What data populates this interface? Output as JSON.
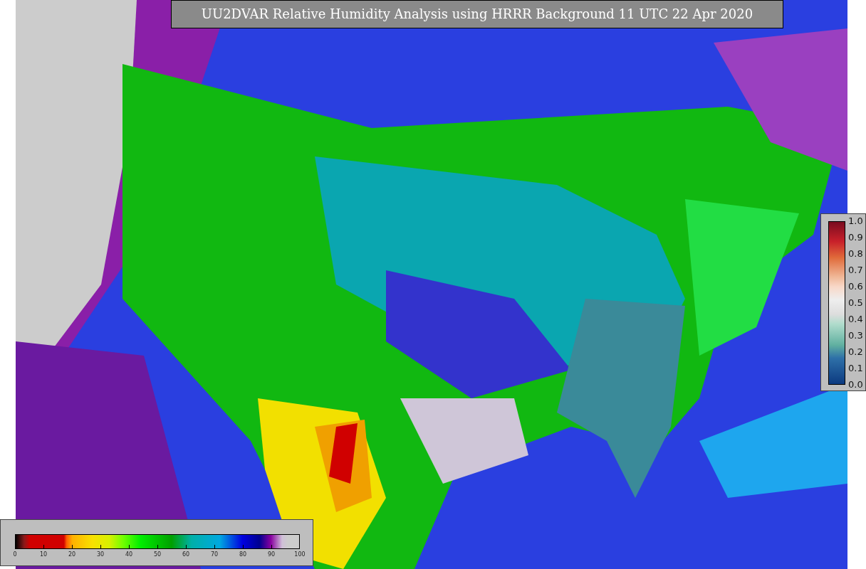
{
  "title": "UU2DVAR Relative Humidity Analysis using HRRR Background 11 UTC 22 Apr 2020",
  "humidity_scale": {
    "ticks": [
      "0",
      "10",
      "20",
      "30",
      "40",
      "50",
      "60",
      "70",
      "80",
      "90",
      "100"
    ]
  },
  "observation_scale": {
    "ticks": [
      "1.0",
      "0.9",
      "0.8",
      "0.7",
      "0.6",
      "0.5",
      "0.4",
      "0.3",
      "0.2",
      "0.1",
      "0.0"
    ]
  }
}
